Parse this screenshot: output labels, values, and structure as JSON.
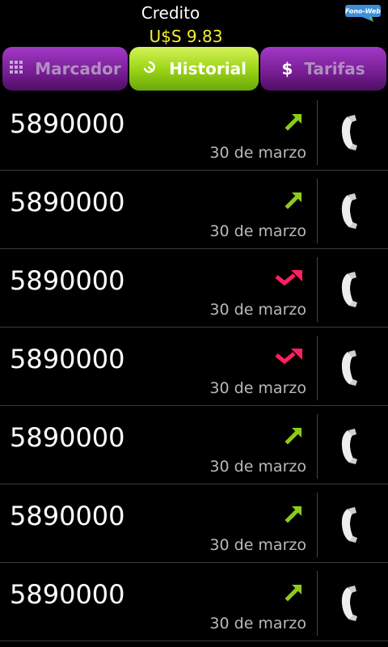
{
  "header": {
    "credit_label": "Credito",
    "credit_amount": "U$S 9.83",
    "logo_text": "Fono-Web"
  },
  "tabs": [
    {
      "label": "Marcador",
      "icon": "dialpad-icon",
      "selected": false
    },
    {
      "label": "Historial",
      "icon": "history-icon",
      "selected": true
    },
    {
      "label": "Tarifas",
      "icon": "dollar-icon",
      "selected": false
    }
  ],
  "colors": {
    "accent_green": "#8ccc19",
    "accent_purple": "#8a2aaa",
    "missed_red": "#ff2060",
    "credit_yellow": "#f4ee36"
  },
  "calls": [
    {
      "number": "5890000",
      "date": "30 de marzo",
      "type": "outgoing"
    },
    {
      "number": "5890000",
      "date": "30 de marzo",
      "type": "outgoing"
    },
    {
      "number": "5890000",
      "date": "30 de marzo",
      "type": "missed"
    },
    {
      "number": "5890000",
      "date": "30 de marzo",
      "type": "missed"
    },
    {
      "number": "5890000",
      "date": "30 de marzo",
      "type": "outgoing"
    },
    {
      "number": "5890000",
      "date": "30 de marzo",
      "type": "outgoing"
    },
    {
      "number": "5890000",
      "date": "30 de marzo",
      "type": "outgoing"
    }
  ]
}
